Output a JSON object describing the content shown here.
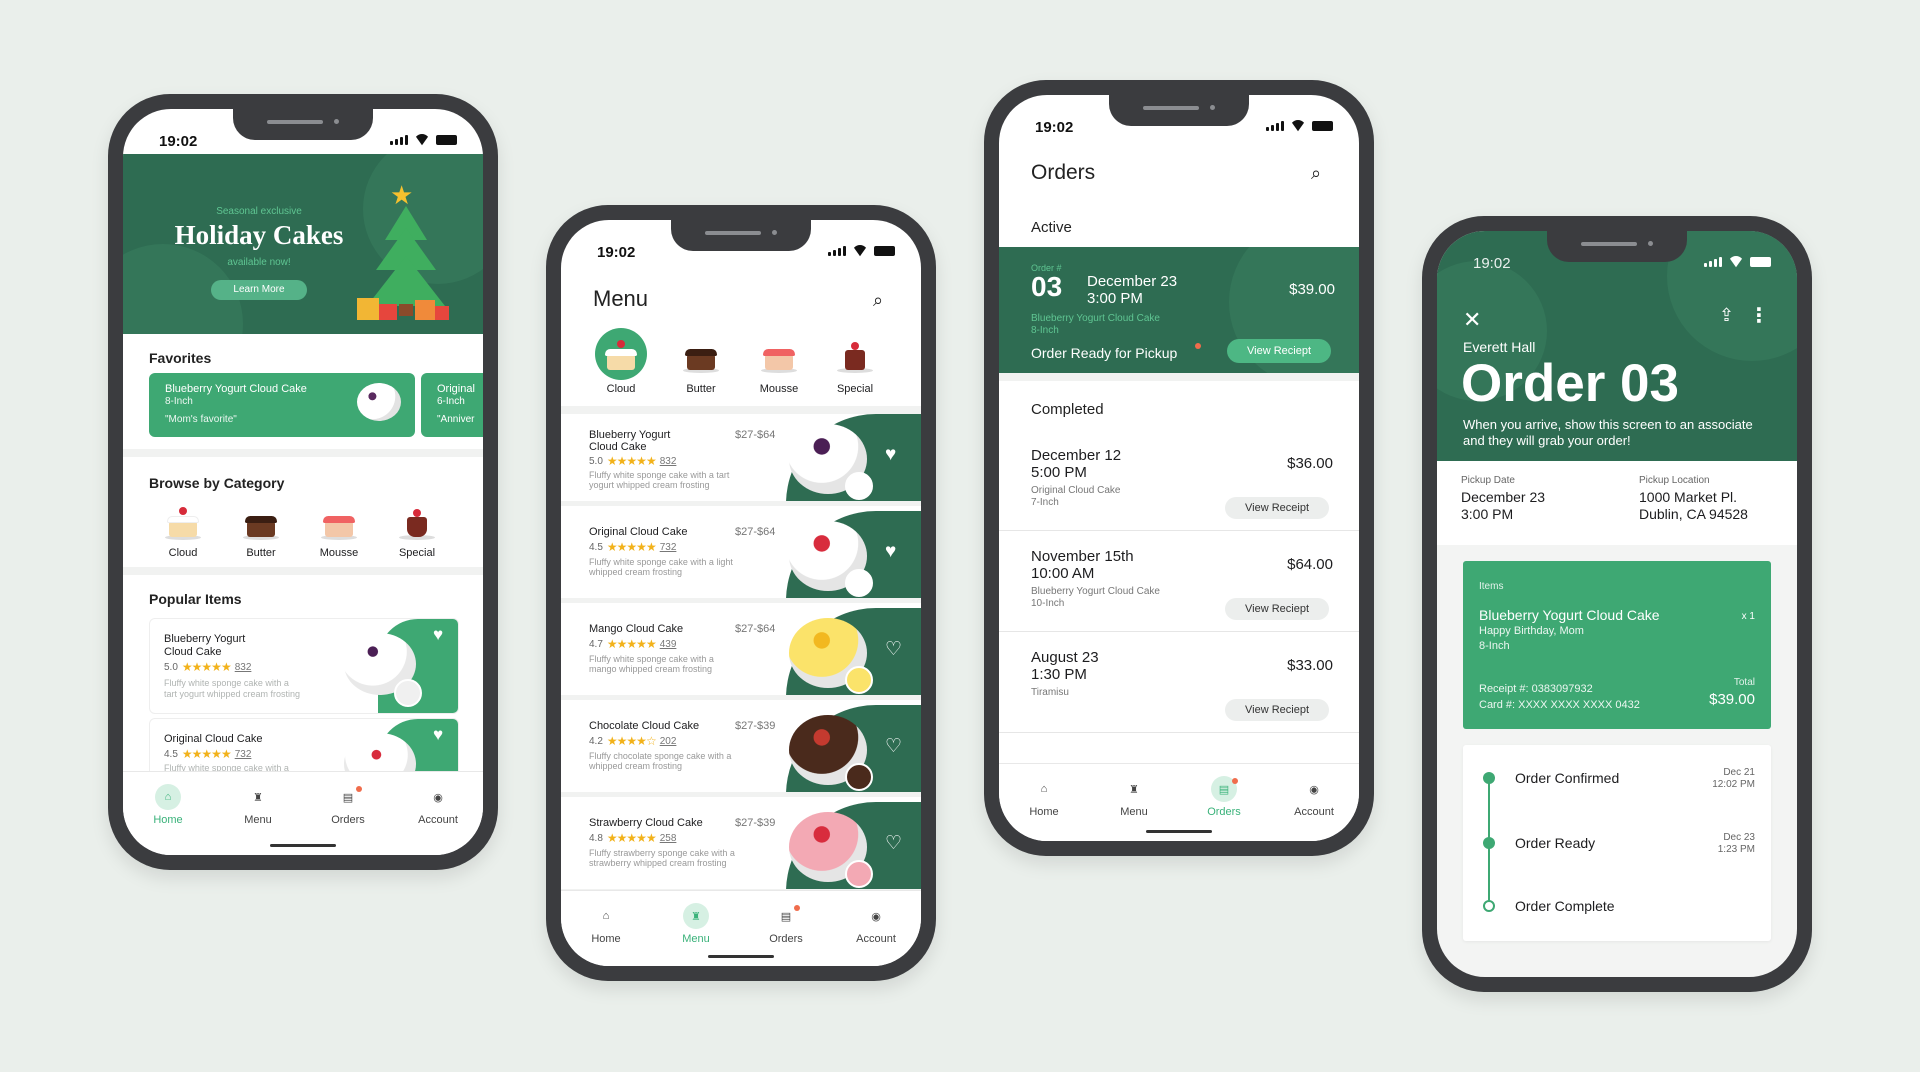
{
  "status_time": "19:02",
  "tabs": [
    "Home",
    "Menu",
    "Orders",
    "Account"
  ],
  "home": {
    "banner": {
      "kicker": "Seasonal exclusive",
      "title": "Holiday Cakes",
      "sub": "available now!",
      "button": "Learn More"
    },
    "favorites_title": "Favorites",
    "favorites": [
      {
        "name": "Blueberry Yogurt Cloud Cake",
        "size": "8-Inch",
        "note": "\"Mom's favorite\""
      },
      {
        "name": "Original",
        "size": "6-Inch",
        "note": "\"Anniver"
      }
    ],
    "browse_title": "Browse by Category",
    "categories": [
      "Cloud",
      "Butter",
      "Mousse",
      "Special"
    ],
    "popular_title": "Popular Items",
    "popular": [
      {
        "name1": "Blueberry Yogurt",
        "name2": "Cloud Cake",
        "rating": "5.0",
        "stars": "★★★★★",
        "count": "832",
        "desc1": "Fluffy white sponge cake with a",
        "desc2": "tart yogurt whipped cream frosting"
      },
      {
        "name1": "Original Cloud Cake",
        "name2": "",
        "rating": "4.5",
        "stars": "★★★★★",
        "count": "732",
        "desc1": "Fluffy white sponge cake with a",
        "desc2": ""
      }
    ]
  },
  "menu": {
    "title": "Menu",
    "categories": [
      "Cloud",
      "Butter",
      "Mousse",
      "Special"
    ],
    "items": [
      {
        "name1": "Blueberry Yogurt",
        "name2": "Cloud Cake",
        "price": "$27-$64",
        "rating": "5.0",
        "stars": "★★★★★",
        "count": "832",
        "desc1": "Fluffy white sponge cake with a tart",
        "desc2": "yogurt whipped cream frosting",
        "heart": "♥"
      },
      {
        "name1": "Original Cloud Cake",
        "name2": "",
        "price": "$27-$64",
        "rating": "4.5",
        "stars": "★★★★★",
        "count": "732",
        "desc1": "Fluffy white sponge cake with a light",
        "desc2": "whipped cream frosting",
        "heart": "♥"
      },
      {
        "name1": "Mango Cloud Cake",
        "name2": "",
        "price": "$27-$64",
        "rating": "4.7",
        "stars": "★★★★★",
        "count": "439",
        "desc1": "Fluffy white sponge cake with a",
        "desc2": "mango whipped cream frosting",
        "heart": "♡"
      },
      {
        "name1": "Chocolate Cloud Cake",
        "name2": "",
        "price": "$27-$39",
        "rating": "4.2",
        "stars": "★★★★☆",
        "count": "202",
        "desc1": "Fluffy chocolate sponge cake with a",
        "desc2": "whipped cream frosting",
        "heart": "♡"
      },
      {
        "name1": "Strawberry Cloud Cake",
        "name2": "",
        "price": "$27-$39",
        "rating": "4.8",
        "stars": "★★★★★",
        "count": "258",
        "desc1": "Fluffy strawberry sponge cake with a",
        "desc2": "strawberry whipped cream frosting",
        "heart": "♡"
      }
    ]
  },
  "orders": {
    "title": "Orders",
    "active_label": "Active",
    "active": {
      "order_label": "Order #",
      "order_no": "03",
      "date": "December 23",
      "time": "3:00 PM",
      "price": "$39.00",
      "item": "Blueberry Yogurt Cloud Cake",
      "size": "8-Inch",
      "status": "Order Ready for Pickup",
      "button": "View Reciept"
    },
    "completed_label": "Completed",
    "completed": [
      {
        "date": "December 12",
        "time": "5:00 PM",
        "price": "$36.00",
        "item": "Original Cloud Cake",
        "size": "7-Inch",
        "button": "View Receipt"
      },
      {
        "date": "November 15th",
        "time": "10:00 AM",
        "price": "$64.00",
        "item": "Blueberry Yogurt Cloud Cake",
        "size": "10-Inch",
        "button": "View Reciept"
      },
      {
        "date": "August 23",
        "time": "1:30 PM",
        "price": "$33.00",
        "item": "Tiramisu",
        "size": "",
        "button": "View Reciept"
      }
    ]
  },
  "detail": {
    "customer": "Everett Hall",
    "title": "Order 03",
    "message": "When you arrive, show this screen to an associate and they will grab your order!",
    "pickup_date_label": "Pickup Date",
    "pickup_date": "December 23",
    "pickup_time": "3:00 PM",
    "pickup_loc_label": "Pickup Location",
    "pickup_loc1": "1000 Market Pl.",
    "pickup_loc2": "Dublin, CA 94528",
    "items_label": "Items",
    "item_name": "Blueberry Yogurt Cloud Cake",
    "item_qty": "x 1",
    "item_note": "Happy Birthday, Mom",
    "item_size": "8-Inch",
    "receipt": "Receipt #: 0383097932",
    "card": "Card #: XXXX XXXX XXXX 0432",
    "total_label": "Total",
    "total": "$39.00",
    "timeline": [
      {
        "label": "Order Confirmed",
        "date": "Dec 21",
        "time": "12:02 PM"
      },
      {
        "label": "Order Ready",
        "date": "Dec 23",
        "time": "1:23 PM"
      },
      {
        "label": "Order Complete",
        "date": "",
        "time": ""
      }
    ]
  }
}
